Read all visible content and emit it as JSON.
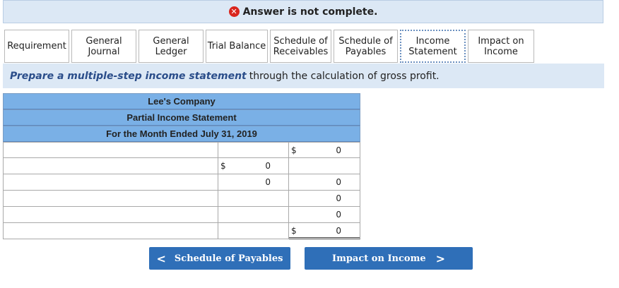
{
  "banner": {
    "text": "Answer is not complete."
  },
  "tabs": [
    {
      "label": "Requirement",
      "active": false
    },
    {
      "label": "General\nJournal",
      "active": false
    },
    {
      "label": "General\nLedger",
      "active": false
    },
    {
      "label": "Trial Balance",
      "active": false
    },
    {
      "label": "Schedule of\nReceivables",
      "active": false
    },
    {
      "label": "Schedule of\nPayables",
      "active": false
    },
    {
      "label": "Income\nStatement",
      "active": true
    },
    {
      "label": "Impact on\nIncome",
      "active": false
    }
  ],
  "instruction": {
    "emphasis": "Prepare a multiple-step income statement",
    "rest": "through the calculation of gross profit."
  },
  "statement": {
    "company": "Lee's Company",
    "title": "Partial Income Statement",
    "period": "For the Month Ended July 31, 2019"
  },
  "rows": [
    {
      "label": "",
      "col2_dollar": "",
      "col2_value": "",
      "col3_dollar": "$",
      "col3_value": "0"
    },
    {
      "label": "",
      "col2_dollar": "$",
      "col2_value": "0",
      "col3_dollar": "",
      "col3_value": ""
    },
    {
      "label": "",
      "col2_dollar": "",
      "col2_value": "0",
      "col3_dollar": "",
      "col3_value": "0"
    },
    {
      "label": "",
      "col2_dollar": "",
      "col2_value": "",
      "col3_dollar": "",
      "col3_value": "0"
    },
    {
      "label": "",
      "col2_dollar": "",
      "col2_value": "",
      "col3_dollar": "",
      "col3_value": "0"
    },
    {
      "label": "",
      "col2_dollar": "",
      "col2_value": "",
      "col3_dollar": "$",
      "col3_value": "0"
    }
  ],
  "nav": {
    "prev_label": "Schedule of Payables",
    "next_label": "Impact on Income",
    "prev_chevron": "<",
    "next_chevron": ">"
  }
}
